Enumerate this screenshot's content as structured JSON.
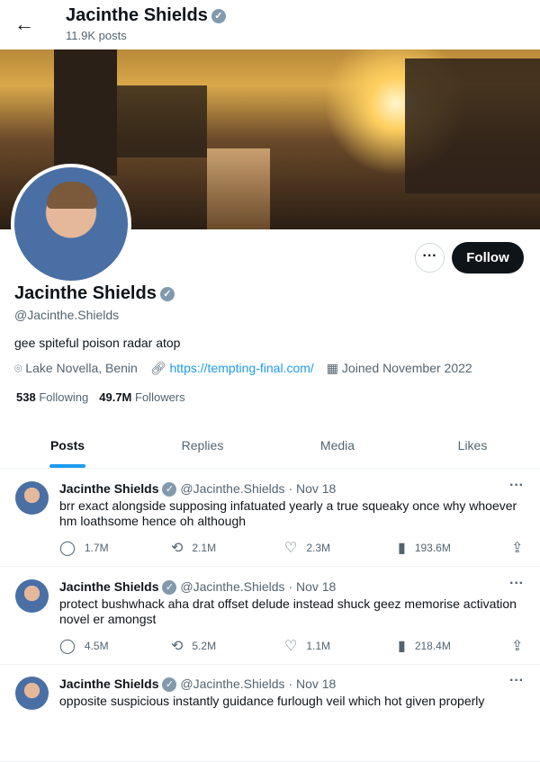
{
  "header": {
    "title": "Jacinthe Shields",
    "posts": "11.9K posts"
  },
  "profile": {
    "name": "Jacinthe Shields",
    "handle": "@Jacinthe.Shields",
    "bio": "gee spiteful poison radar atop",
    "location": "Lake Novella, Benin",
    "url": "https://tempting-final.com/",
    "joined": "Joined November 2022",
    "following_count": "538",
    "following_label": "Following",
    "followers_count": "49.7M",
    "followers_label": "Followers",
    "follow_label": "Follow",
    "more_label": "···"
  },
  "tabs": [
    {
      "label": "Posts"
    },
    {
      "label": "Replies"
    },
    {
      "label": "Media"
    },
    {
      "label": "Likes"
    }
  ],
  "tweets": [
    {
      "name": "Jacinthe Shields",
      "handle": "@Jacinthe.Shields",
      "date": "· Nov 18",
      "text": "brr exact alongside supposing infatuated yearly a true squeaky once why whoever hm loathsome hence oh although",
      "replies": "1.7M",
      "retweets": "2.1M",
      "likes": "2.3M",
      "views": "193.6M"
    },
    {
      "name": "Jacinthe Shields",
      "handle": "@Jacinthe.Shields",
      "date": "· Nov 18",
      "text": "protect bushwhack aha drat offset delude instead shuck geez memorise activation novel er amongst",
      "replies": "4.5M",
      "retweets": "5.2M",
      "likes": "1.1M",
      "views": "218.4M"
    },
    {
      "name": "Jacinthe Shields",
      "handle": "@Jacinthe.Shields",
      "date": "· Nov 18",
      "text": "opposite suspicious instantly guidance furlough veil which hot given properly"
    }
  ],
  "colors": {
    "accent": "#1d9bf0",
    "text": "#0f1419",
    "muted": "#536471"
  }
}
